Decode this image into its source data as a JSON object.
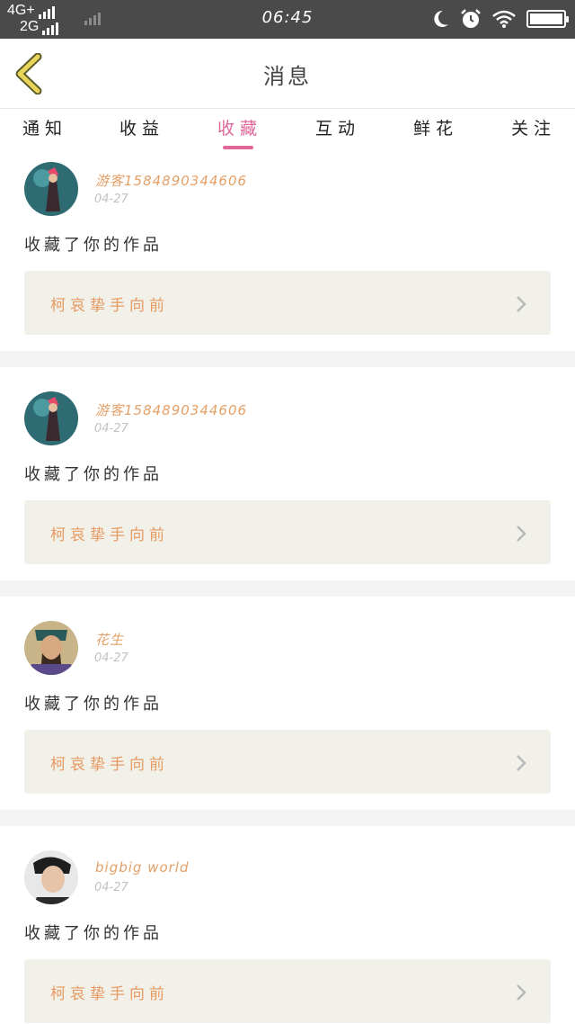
{
  "status_bar": {
    "net1": "4G+",
    "net2": "2G",
    "time": "06:45",
    "icons": [
      "moon-icon",
      "alarm-icon",
      "wifi-icon",
      "battery-icon"
    ]
  },
  "header": {
    "title": "消息",
    "back_icon": "back-chevron-icon"
  },
  "tabs": [
    {
      "label": "通知",
      "active": false
    },
    {
      "label": "收益",
      "active": false
    },
    {
      "label": "收藏",
      "active": true
    },
    {
      "label": "互动",
      "active": false
    },
    {
      "label": "鲜花",
      "active": false
    },
    {
      "label": "关注",
      "active": false
    }
  ],
  "messages": [
    {
      "user": "游客15848903446​06",
      "date": "04-27",
      "action": "收藏了你的作品",
      "work": "柯哀挚手向前"
    },
    {
      "user": "游客15848903446​06",
      "date": "04-27",
      "action": "收藏了你的作品",
      "work": "柯哀挚手向前"
    },
    {
      "user": "花生",
      "date": "04-27",
      "action": "收藏了你的作品",
      "work": "柯哀挚手向前"
    },
    {
      "user": "bigbig world",
      "date": "04-27",
      "action": "收藏了你的作品",
      "work": "柯哀挚手向前"
    }
  ],
  "colors": {
    "accent": "#e0679a",
    "username": "#e3a067",
    "work_title": "#e79a62",
    "work_bg": "#f1f1ea",
    "status_bg": "#4a4a4a"
  }
}
